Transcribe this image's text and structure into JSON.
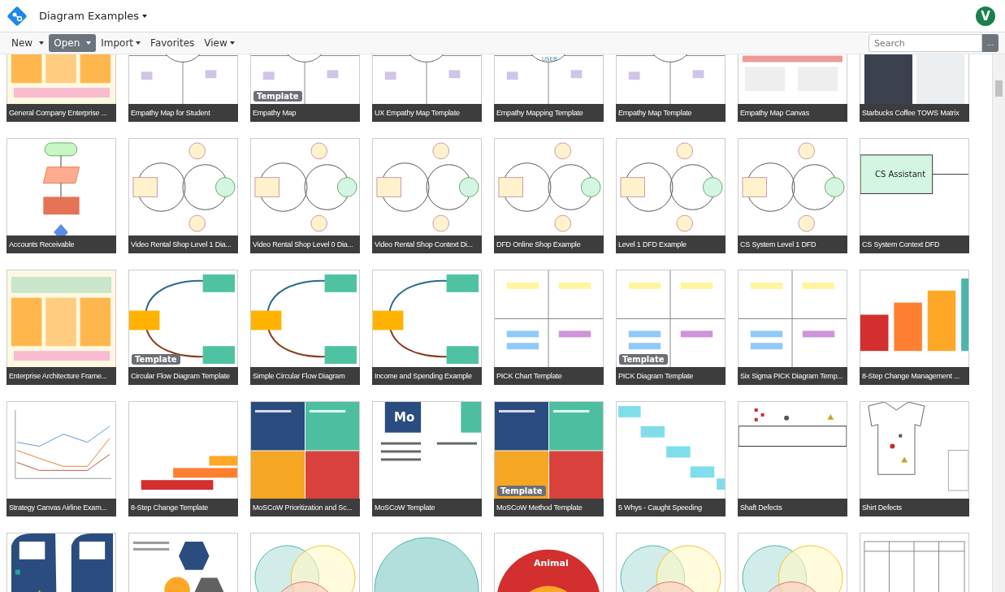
{
  "header": {
    "title": "Diagram Examples",
    "avatar": "V"
  },
  "menu": [
    {
      "label": "New",
      "selected": false,
      "dropdown": true
    },
    {
      "label": "Open",
      "selected": true,
      "dropdown": true
    },
    {
      "label": "Import",
      "selected": false,
      "dropdown": true
    },
    {
      "label": "Favorites",
      "selected": false,
      "dropdown": false
    },
    {
      "label": "View",
      "selected": false,
      "dropdown": true
    }
  ],
  "search": {
    "placeholder": "Search",
    "button": "..."
  },
  "templates": [
    {
      "title": "General Company Enterprise ...",
      "kind": "blocks",
      "badge": false
    },
    {
      "title": "Empathy Map for Student",
      "kind": "empathy",
      "badge": false
    },
    {
      "title": "Empathy Map",
      "kind": "empathy",
      "badge": "Template"
    },
    {
      "title": "UX Empathy Map Template",
      "kind": "empathy",
      "badge": false
    },
    {
      "title": "Empathy Mapping Template",
      "kind": "empathy",
      "badge": false,
      "headline": "USER"
    },
    {
      "title": "Empathy Map Template",
      "kind": "empathy",
      "badge": false
    },
    {
      "title": "Empathy Map Canvas",
      "kind": "canvas",
      "badge": false
    },
    {
      "title": "Starbucks Coffee TOWS Matrix",
      "kind": "dark",
      "badge": false
    },
    {
      "title": "Accounts Receivable",
      "kind": "flowchart",
      "badge": false
    },
    {
      "title": "Video Rental Shop Level 1 Dia...",
      "kind": "flow",
      "badge": false
    },
    {
      "title": "Video Rental Shop Level 0 Dia...",
      "kind": "flow",
      "badge": false
    },
    {
      "title": "Video Rental Shop Context Di...",
      "kind": "flow",
      "badge": false
    },
    {
      "title": "DFD Online Shop Example",
      "kind": "flow",
      "badge": false
    },
    {
      "title": "Level 1 DFD Example",
      "kind": "flow",
      "badge": false
    },
    {
      "title": "CS System Level 1 DFD",
      "kind": "flow",
      "badge": false
    },
    {
      "title": "CS System Context DFD",
      "kind": "box",
      "badge": false,
      "headline": "CS Assistant"
    },
    {
      "title": "Enterprise Architecture Frame...",
      "kind": "blocks",
      "badge": false
    },
    {
      "title": "Circular Flow Diagram Template",
      "kind": "circular",
      "badge": "Template"
    },
    {
      "title": "Simple Circular Flow Diagram",
      "kind": "circular",
      "badge": false
    },
    {
      "title": "Income and Spending Example",
      "kind": "circular",
      "badge": false
    },
    {
      "title": "PICK Chart Template",
      "kind": "pick",
      "badge": false
    },
    {
      "title": "PICK Diagram Template",
      "kind": "pick",
      "badge": "Template"
    },
    {
      "title": "Six Sigma PICK Diagram Temp...",
      "kind": "pick",
      "badge": false
    },
    {
      "title": "8-Step Change Management ...",
      "kind": "steps",
      "badge": false
    },
    {
      "title": "Strategy Canvas Airline Exam...",
      "kind": "line",
      "badge": false
    },
    {
      "title": "8-Step Change Template",
      "kind": "stairs",
      "badge": false
    },
    {
      "title": "MoSCoW Prioritization and Sc...",
      "kind": "quad",
      "badge": false
    },
    {
      "title": "MoSCoW Template",
      "kind": "tiles",
      "badge": false,
      "headline": "Mo"
    },
    {
      "title": "MoSCoW Method Template",
      "kind": "quad",
      "badge": "Template"
    },
    {
      "title": "5 Whys - Caught Speeding",
      "kind": "whys",
      "badge": false
    },
    {
      "title": "Shaft Defects",
      "kind": "shaft",
      "badge": false
    },
    {
      "title": "Shirt Defects",
      "kind": "shirt",
      "badge": false
    },
    {
      "kind": "doors",
      "badge": false
    },
    {
      "kind": "mind",
      "badge": false
    },
    {
      "kind": "venn",
      "badge": false
    },
    {
      "kind": "rings",
      "badge": false
    },
    {
      "kind": "donut",
      "badge": false,
      "headline": "Animal"
    },
    {
      "kind": "venn",
      "badge": false
    },
    {
      "kind": "venn",
      "badge": false
    },
    {
      "kind": "table",
      "badge": false
    }
  ]
}
